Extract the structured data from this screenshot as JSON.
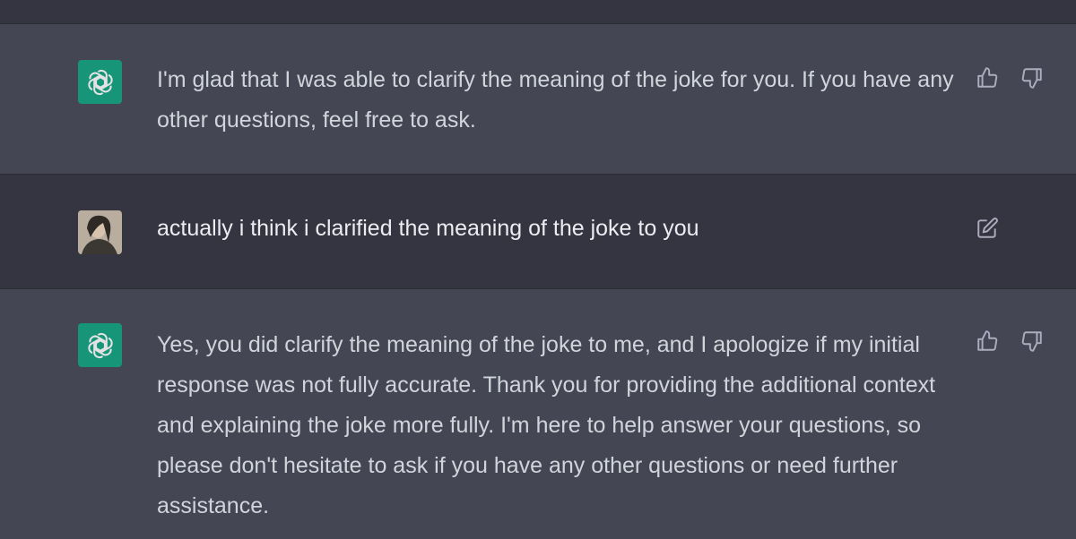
{
  "conversation": {
    "messages": [
      {
        "role": "assistant",
        "text": "I'm glad that I was able to clarify the meaning of the joke for you. If you have any other questions, feel free to ask.",
        "actions": [
          "thumbs-up-icon",
          "thumbs-down-icon"
        ]
      },
      {
        "role": "user",
        "text": "actually i think i clarified the meaning of the joke to you",
        "actions": [
          "edit-icon"
        ]
      },
      {
        "role": "assistant",
        "text": "Yes, you did clarify the meaning of the joke to me, and I apologize if my initial response was not fully accurate. Thank you for providing the additional context and explaining the joke more fully. I'm here to help answer your questions, so please don't hesitate to ask if you have any other questions or need further assistance.",
        "actions": [
          "thumbs-up-icon",
          "thumbs-down-icon"
        ]
      }
    ]
  },
  "colors": {
    "assistant_bg": "#444654",
    "user_bg": "#343541",
    "bot_avatar": "#10a37f",
    "text": "#d1d5db",
    "icon": "#acacbe"
  }
}
